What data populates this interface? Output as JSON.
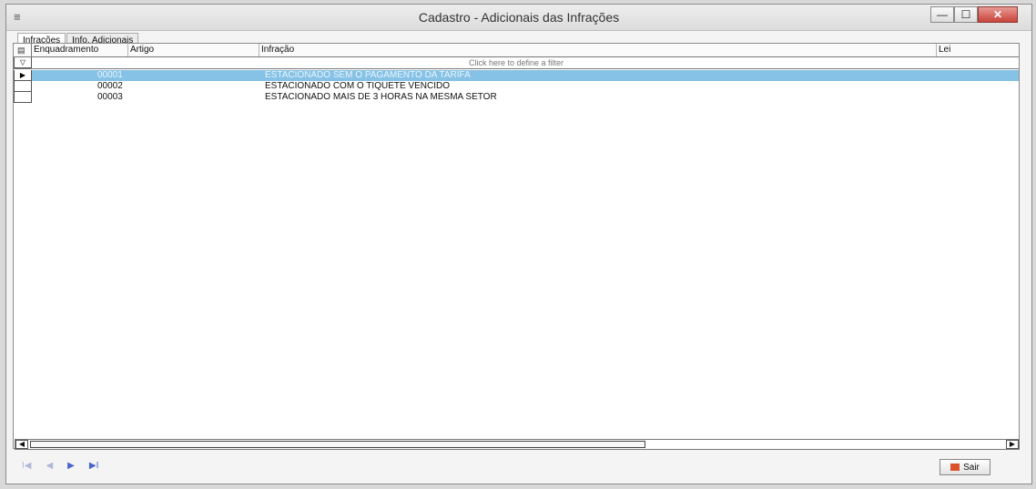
{
  "window": {
    "title": "Cadastro - Adicionais das Infrações",
    "controls": {
      "minimize": "—",
      "maximize": "☐",
      "close": "✕"
    }
  },
  "tabs": [
    {
      "label": "Infrações",
      "active": true
    },
    {
      "label": "Info. Adicionais",
      "active": false
    }
  ],
  "grid": {
    "columns": [
      "Enquadramento",
      "Artigo",
      "Infração",
      "Lei"
    ],
    "filter_hint": "Click here to define a filter",
    "rows": [
      {
        "enquadramento": "00001",
        "artigo": "",
        "infracao": "ESTACIONADO SEM O PAGAMENTO DA TARIFA",
        "lei": "",
        "selected": true
      },
      {
        "enquadramento": "00002",
        "artigo": "",
        "infracao": "ESTACIONADO COM O TIQUETE VENCIDO",
        "lei": "",
        "selected": false
      },
      {
        "enquadramento": "00003",
        "artigo": "",
        "infracao": "ESTACIONADO MAIS DE 3 HORAS NA MESMA SETOR",
        "lei": "",
        "selected": false
      }
    ]
  },
  "navigator": {
    "first": "I◀",
    "prev": "◀",
    "next": "▶",
    "last": "▶I"
  },
  "footer": {
    "exit_label": "Sair"
  },
  "colors": {
    "selection": "#86c2e6",
    "close": "#c9433a",
    "nav": "#4a63c9"
  }
}
